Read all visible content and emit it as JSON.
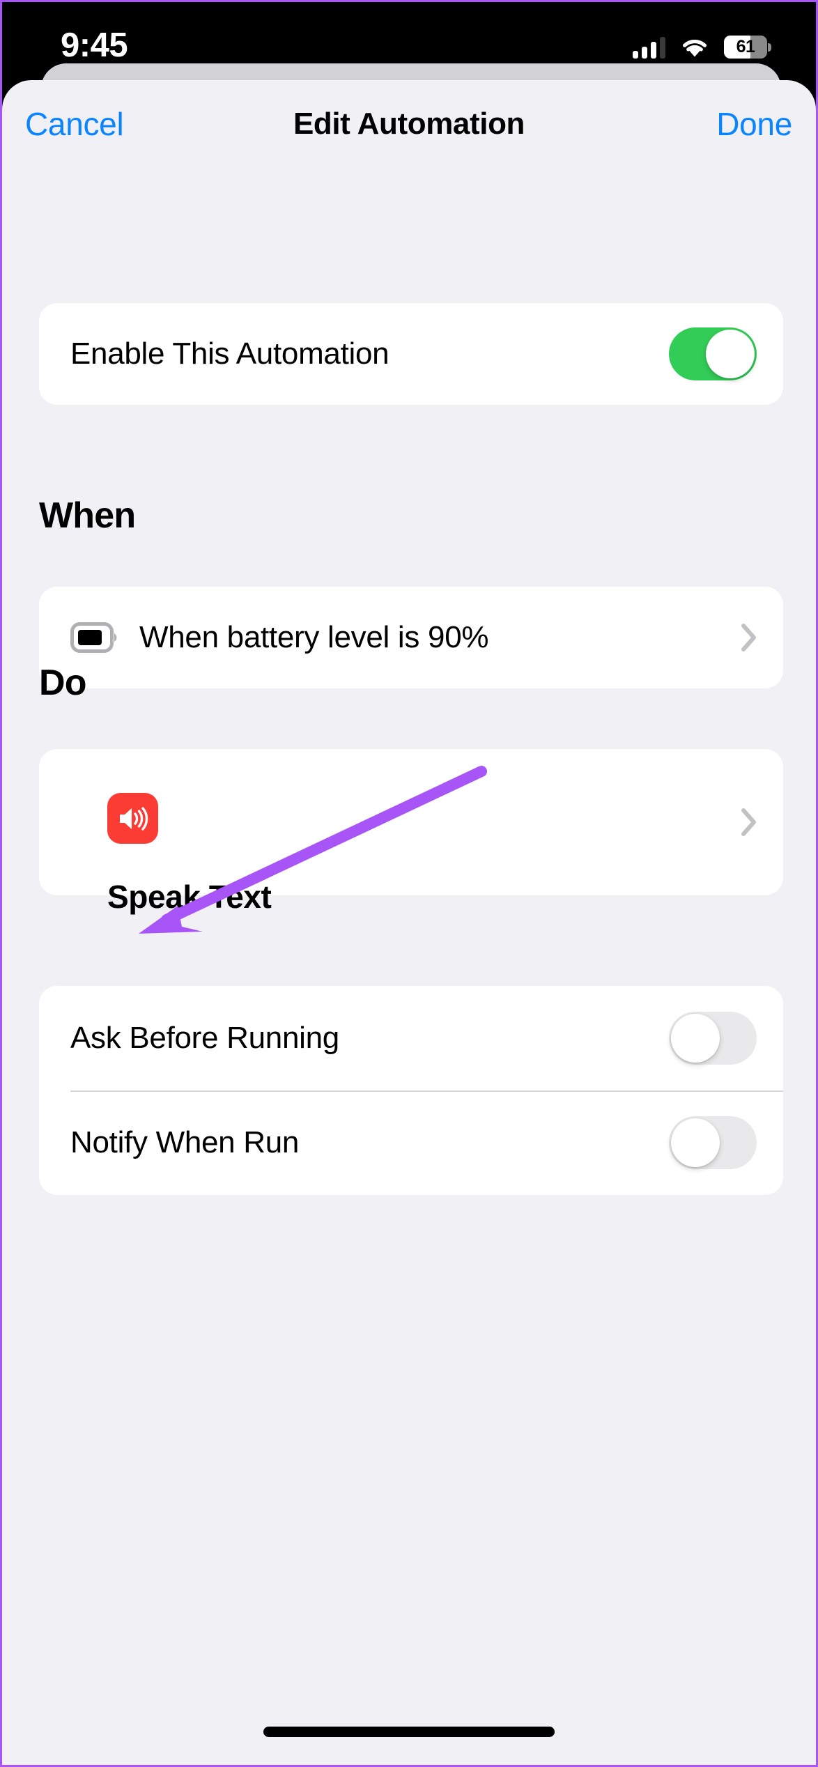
{
  "status_bar": {
    "time": "9:45",
    "battery_percent": "61",
    "battery_level": 61,
    "signal_bars_filled": 3,
    "signal_bars_total": 4,
    "wifi": "wifi-icon"
  },
  "nav": {
    "cancel_label": "Cancel",
    "title": "Edit Automation",
    "done_label": "Done"
  },
  "enable_section": {
    "label": "Enable This Automation",
    "state": "on"
  },
  "when_section": {
    "header": "When",
    "trigger_label": "When battery level is 90%",
    "trigger_icon": "battery-icon",
    "battery_threshold": "90%"
  },
  "do_section": {
    "header": "Do",
    "action_label": "Speak Text",
    "action_icon": "speaker-wave-icon"
  },
  "options_section": {
    "rows": [
      {
        "label": "Ask Before Running",
        "state": "off"
      },
      {
        "label": "Notify When Run",
        "state": "off"
      }
    ]
  },
  "annotation": {
    "type": "arrow",
    "color": "#A855F7",
    "points_to": "speaker-wave-icon"
  },
  "colors": {
    "accent_blue": "#0A84FF",
    "toggle_on_green": "#32CD57",
    "toggle_off_gray": "#E9E9EB",
    "action_icon_red": "#FA3C34",
    "sheet_background": "#F1F0F5",
    "card_white": "#FFFFFF",
    "annotation_purple": "#A855F7",
    "chevron_gray": "#C2C2C6"
  }
}
